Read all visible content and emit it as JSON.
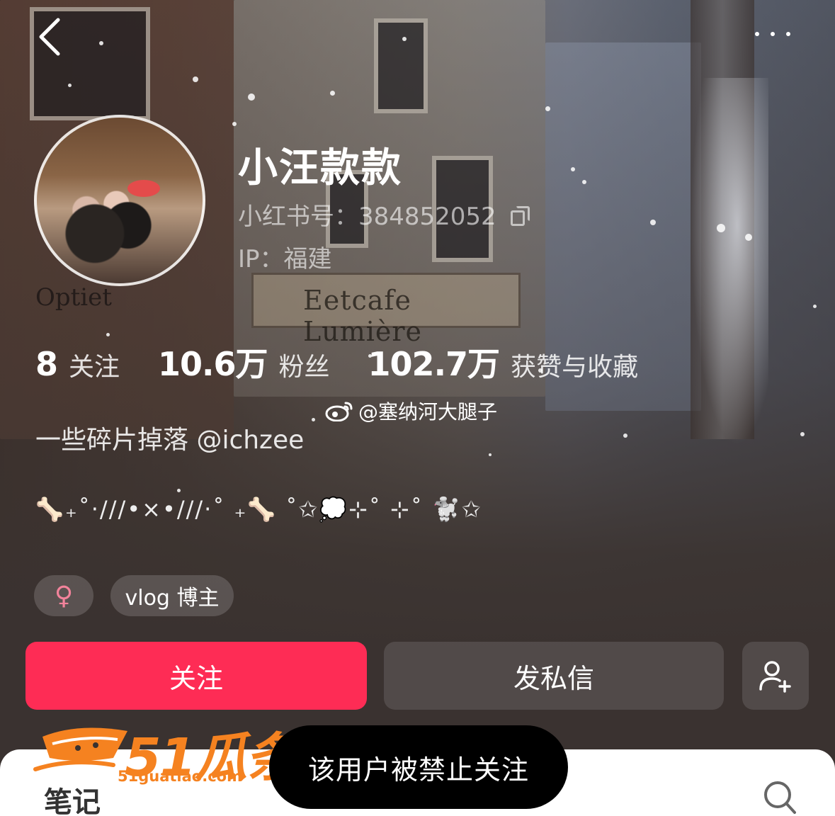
{
  "profile": {
    "name": "小汪款款",
    "red_id": "小红书号：384852052",
    "ip": "IP：福建",
    "bio": "一些碎片掉落 @ichzee",
    "decor_line": "🦴₊˚‧///•×•///‧˚ ₊🦴 ˚✩💭⊹˚ ⊹˚ 🐩✩"
  },
  "stats": [
    {
      "num": "8",
      "label": "关注"
    },
    {
      "num": "10.6万",
      "label": "粉丝"
    },
    {
      "num": "102.7万",
      "label": "获赞与收藏"
    }
  ],
  "weibo": {
    "handle": "@塞纳河大腿子",
    "icon": "weibo-icon"
  },
  "tags": {
    "gender": "♀",
    "vlog": "vlog 博主"
  },
  "actions": {
    "follow": "关注",
    "message": "发私信",
    "add_friend_icon": "add-user-icon"
  },
  "bottom": {
    "tab_notes": "笔记",
    "search_icon": "search-icon"
  },
  "toast": {
    "text": "该用户被禁止关注"
  },
  "watermark": {
    "text": "51瓜条",
    "url": "51guatiao.com"
  },
  "background_sign": {
    "shop": "Eetcafe Lumière",
    "optic": "Optiet"
  },
  "colors": {
    "follow_button": "#fe2c55",
    "watermark": "#f58220",
    "gender": "#f2839b"
  }
}
